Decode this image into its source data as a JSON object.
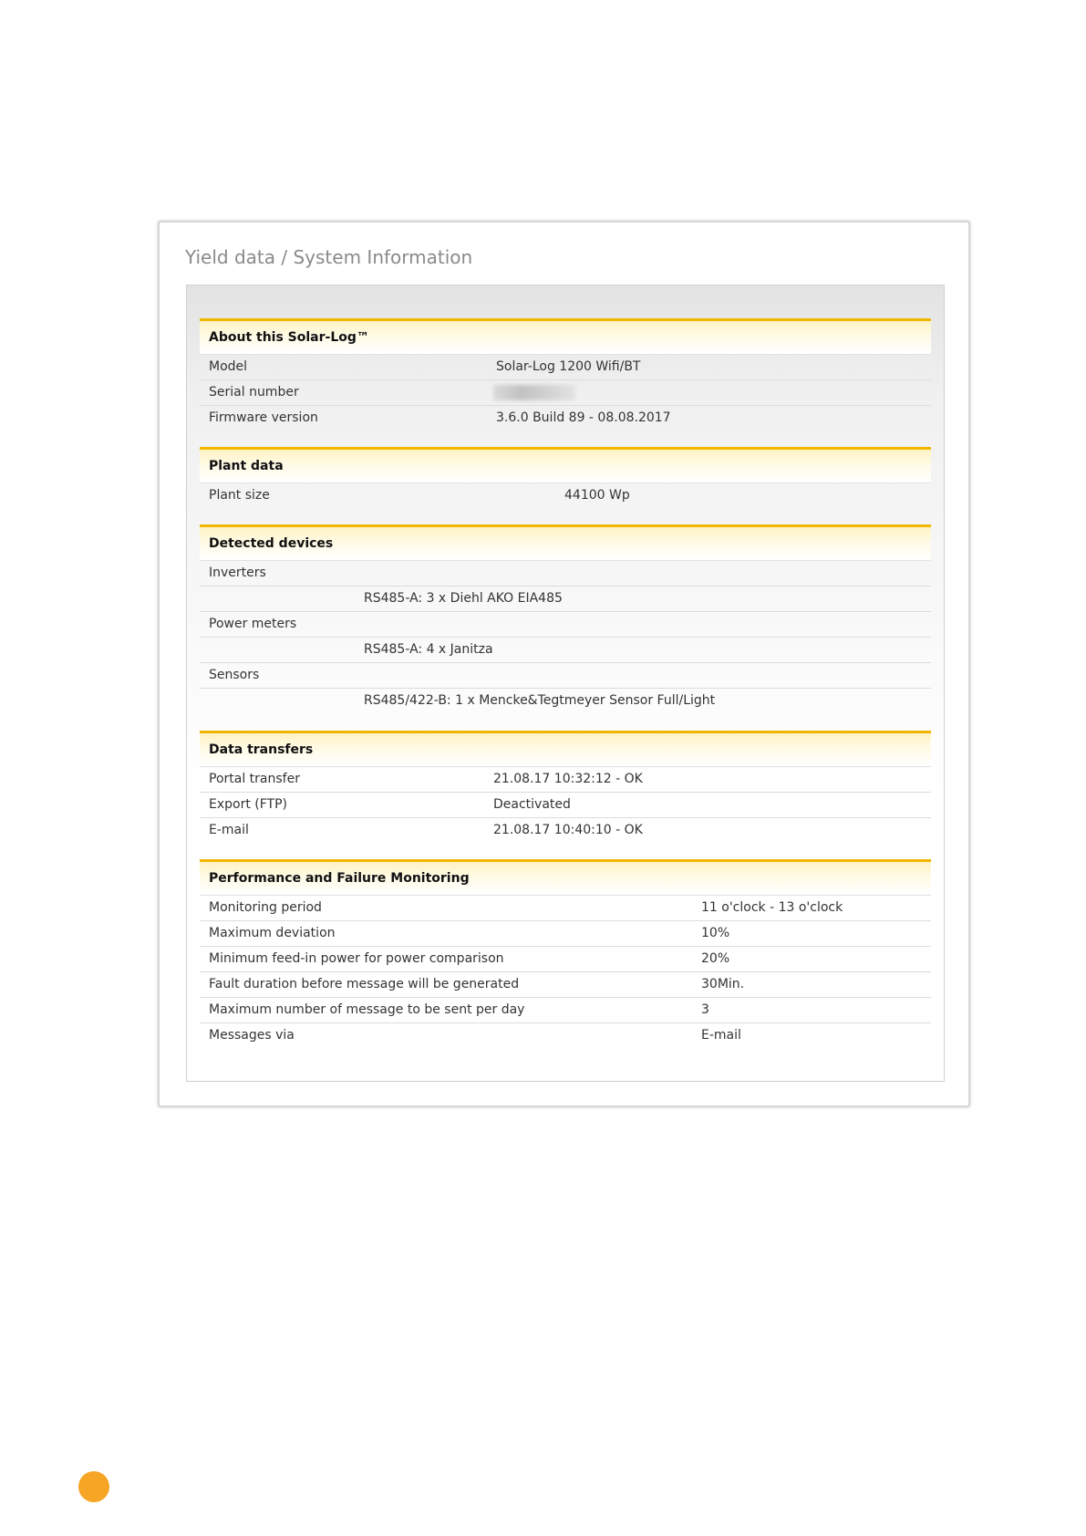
{
  "window": {
    "title": "Yield data / System Information"
  },
  "about": {
    "header": "About this Solar-Log™",
    "rows": [
      {
        "label": "Model",
        "value": "Solar-Log 1200 Wifi/BT"
      },
      {
        "label": "Serial number",
        "value": ""
      },
      {
        "label": "Firmware version",
        "value": "3.6.0 Build 89 - 08.08.2017"
      }
    ]
  },
  "plant": {
    "header": "Plant data",
    "rows": [
      {
        "label": "Plant size",
        "value": "44100 Wp"
      }
    ]
  },
  "devices": {
    "header": "Detected devices",
    "rows": [
      {
        "label": "Inverters",
        "value": "RS485-A: 3 x Diehl AKO EIA485"
      },
      {
        "label": "Power meters",
        "value": "RS485-A: 4 x Janitza"
      },
      {
        "label": "Sensors",
        "value": "RS485/422-B: 1 x Mencke&Tegtmeyer Sensor Full/Light"
      }
    ]
  },
  "transfers": {
    "header": "Data transfers",
    "rows": [
      {
        "label": "Portal transfer",
        "value": "21.08.17 10:32:12 - OK"
      },
      {
        "label": "Export (FTP)",
        "value": "Deactivated"
      },
      {
        "label": "E-mail",
        "value": "21.08.17 10:40:10 - OK"
      }
    ]
  },
  "monitoring": {
    "header": "Performance and Failure Monitoring",
    "rows": [
      {
        "label": "Monitoring period",
        "value": "11 o'clock - 13 o'clock"
      },
      {
        "label": "Maximum deviation",
        "value": "10%"
      },
      {
        "label": "Minimum feed-in power for power comparison",
        "value": "20%"
      },
      {
        "label": "Fault duration before message will be generated",
        "value": "30Min."
      },
      {
        "label": "Maximum number of message to be sent per day",
        "value": "3"
      },
      {
        "label": "Messages via",
        "value": "E-mail"
      }
    ]
  },
  "colors": {
    "accent": "#f2b600",
    "page_marker": "#f7a524"
  }
}
